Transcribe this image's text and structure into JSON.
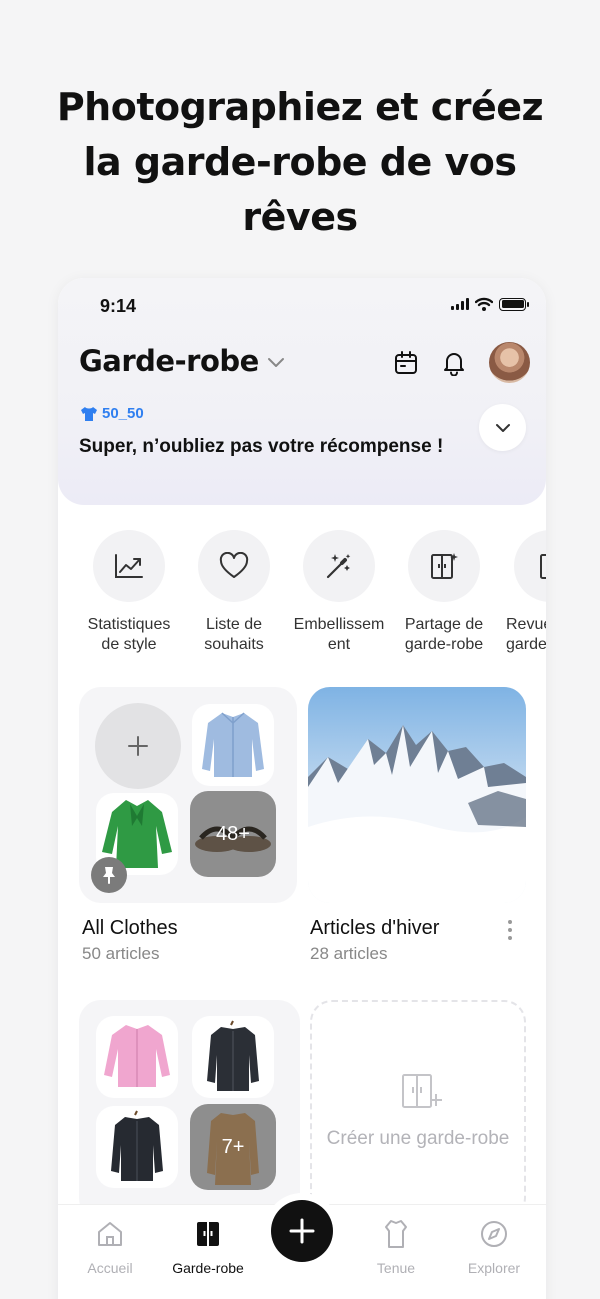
{
  "headline": {
    "line1": "Photographiez et créez",
    "line2": "la garde-robe de vos",
    "line3": "rêves"
  },
  "status_bar": {
    "time": "9:14"
  },
  "header": {
    "title": "Garde-robe"
  },
  "reward": {
    "tag": "50_50",
    "message": "Super, n’oubliez pas votre récompense !"
  },
  "quick_actions": [
    {
      "line1": "Statistiques",
      "line2": "de style",
      "icon": "trend-chart-icon"
    },
    {
      "line1": "Liste de",
      "line2": "souhaits",
      "icon": "heart-icon"
    },
    {
      "line1": "Embellissem",
      "line2": "ent",
      "icon": "magic-wand-icon"
    },
    {
      "line1": "Partage de",
      "line2": "garde-robe",
      "icon": "wardrobe-share-icon"
    },
    {
      "line1": "Revue",
      "line2": "garde",
      "icon": "wardrobe-review-icon"
    }
  ],
  "wardrobes": [
    {
      "name": "All Clothes",
      "count": "50 articles",
      "more_count": "48+"
    },
    {
      "name": "Articles d'hiver",
      "count": "28 articles"
    },
    {
      "more_count": "7+"
    }
  ],
  "create_wardrobe": {
    "label": "Créer une garde-robe"
  },
  "bottom_nav": {
    "items": [
      {
        "label": "Accueil",
        "icon": "home-icon"
      },
      {
        "label": "Garde-robe",
        "icon": "wardrobe-icon"
      },
      {
        "label": "Tenue",
        "icon": "shirt-icon"
      },
      {
        "label": "Explorer",
        "icon": "compass-icon"
      }
    ]
  },
  "colors": {
    "accent_blue": "#2f7ff0",
    "fab": "#111111",
    "inactive": "#b0b0b5"
  }
}
